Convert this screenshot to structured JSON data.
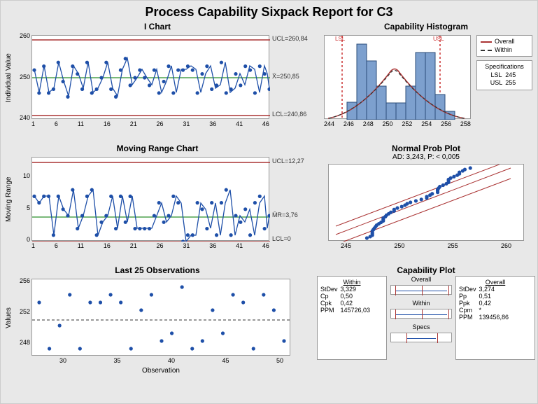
{
  "title": "Process Capability Sixpack Report for C3",
  "iChart": {
    "title": "I Chart",
    "ylabel": "Individual Value",
    "xticks": [
      1,
      6,
      11,
      16,
      21,
      26,
      31,
      36,
      41,
      46
    ],
    "yticks": [
      240,
      250,
      260
    ],
    "ucl_label": "UCL=260,84",
    "mean_label": "X̄=250,85",
    "lcl_label": "LCL=240,86"
  },
  "mrChart": {
    "title": "Moving Range Chart",
    "ylabel": "Moving Range",
    "xticks": [
      1,
      6,
      11,
      16,
      21,
      26,
      31,
      36,
      41,
      46
    ],
    "yticks": [
      0,
      5,
      10
    ],
    "ucl_label": "UCL=12,27",
    "mean_label": "M̄R=3,76",
    "lcl_label": "LCL=0"
  },
  "last25": {
    "title": "Last 25 Observations",
    "ylabel": "Values",
    "xlabel": "Observation",
    "yticks": [
      248,
      252,
      256
    ],
    "xticks": [
      30,
      35,
      40,
      45,
      50
    ]
  },
  "hist": {
    "title": "Capability Histogram",
    "lsl_label": "LSL",
    "usl_label": "USL",
    "xticks": [
      244,
      246,
      248,
      250,
      252,
      254,
      256,
      258
    ],
    "legend": {
      "overall": "Overall",
      "within": "Within"
    },
    "specs_title": "Specifications",
    "specs": {
      "lsl_name": "LSL",
      "lsl_val": "245",
      "usl_name": "USL",
      "usl_val": "255"
    }
  },
  "prob": {
    "title": "Normal Prob Plot",
    "subtitle": "AD: 3,243, P: < 0,005",
    "xticks": [
      245,
      250,
      255,
      260
    ]
  },
  "capPlot": {
    "title": "Capability Plot",
    "within_hdr": "Within",
    "overall_hdr": "Overall",
    "within": {
      "stdev_n": "StDev",
      "stdev_v": "3,329",
      "cp_n": "Cp",
      "cp_v": "0,50",
      "cpk_n": "Cpk",
      "cpk_v": "0,42",
      "ppm_n": "PPM",
      "ppm_v": "145726,03"
    },
    "overall": {
      "stdev_n": "StDev",
      "stdev_v": "3,274",
      "pp_n": "Pp",
      "pp_v": "0,51",
      "ppk_n": "Ppk",
      "ppk_v": "0,42",
      "cpm_n": "Cpm",
      "cpm_v": "*",
      "ppm_n": "PPM",
      "ppm_v": "139456,86"
    },
    "mid": {
      "overall": "Overall",
      "within": "Within",
      "specs": "Specs"
    }
  },
  "chart_data": [
    {
      "type": "line",
      "id": "I Chart",
      "x": [
        1,
        2,
        3,
        4,
        5,
        6,
        7,
        8,
        9,
        10,
        11,
        12,
        13,
        14,
        15,
        16,
        17,
        18,
        19,
        20,
        21,
        22,
        23,
        24,
        25,
        26,
        27,
        28,
        29,
        30,
        31,
        32,
        33,
        34,
        35,
        36,
        37,
        38,
        39,
        40,
        41,
        42,
        43,
        44,
        45,
        46,
        47,
        48,
        49,
        50
      ],
      "values": [
        253,
        247,
        254,
        247,
        248,
        255,
        250,
        246,
        254,
        252,
        248,
        255,
        247,
        248,
        251,
        255,
        248,
        246,
        253,
        256,
        249,
        251,
        253,
        251,
        249,
        253,
        247,
        250,
        254,
        247,
        253,
        253,
        254,
        253,
        247,
        252,
        254,
        248,
        249,
        255,
        247,
        248,
        252,
        249,
        254,
        253,
        247,
        254,
        252,
        248
      ],
      "ucl": 260.84,
      "mean": 250.85,
      "lcl": 240.86,
      "xlim": [
        1,
        50
      ],
      "ylim": [
        240,
        262
      ],
      "title": "I Chart",
      "ylabel": "Individual Value"
    },
    {
      "type": "line",
      "id": "Moving Range Chart",
      "x": [
        1,
        2,
        3,
        4,
        5,
        6,
        7,
        8,
        9,
        10,
        11,
        12,
        13,
        14,
        15,
        16,
        17,
        18,
        19,
        20,
        21,
        22,
        23,
        24,
        25,
        26,
        27,
        28,
        29,
        30,
        31,
        32,
        33,
        34,
        35,
        36,
        37,
        38,
        39,
        40,
        41,
        42,
        43,
        44,
        45,
        46,
        47,
        48,
        49,
        50
      ],
      "values": [
        7,
        6,
        7,
        7,
        1,
        7,
        5,
        4,
        8,
        2,
        4,
        7,
        8,
        1,
        3,
        4,
        7,
        2,
        7,
        3,
        7,
        2,
        2,
        2,
        2,
        4,
        6,
        3,
        4,
        7,
        6,
        0,
        1,
        1,
        6,
        5,
        2,
        6,
        1,
        6,
        8,
        1,
        4,
        3,
        5,
        1,
        6,
        7,
        2,
        4
      ],
      "ucl": 12.27,
      "mean": 3.76,
      "lcl": 0,
      "xlim": [
        1,
        50
      ],
      "ylim": [
        0,
        13
      ],
      "title": "Moving Range Chart",
      "ylabel": "Moving Range"
    },
    {
      "type": "scatter",
      "id": "Last 25 Observations",
      "x": [
        26,
        27,
        28,
        29,
        30,
        31,
        32,
        33,
        34,
        35,
        36,
        37,
        38,
        39,
        40,
        41,
        42,
        43,
        44,
        45,
        46,
        47,
        48,
        49,
        50
      ],
      "values": [
        253,
        247,
        250,
        254,
        247,
        253,
        253,
        254,
        253,
        247,
        252,
        254,
        248,
        249,
        255,
        247,
        248,
        252,
        249,
        254,
        253,
        247,
        254,
        252,
        248
      ],
      "ref": 250.8,
      "xlim": [
        26,
        50
      ],
      "ylim": [
        246,
        256
      ],
      "title": "Last 25 Observations",
      "ylabel": "Values",
      "xlabel": "Observation"
    },
    {
      "type": "bar",
      "id": "Capability Histogram",
      "categories": [
        244,
        245,
        246,
        247,
        248,
        249,
        250,
        251,
        252,
        253,
        254,
        255,
        256,
        257,
        258
      ],
      "values": [
        0,
        0,
        2,
        9,
        7,
        4,
        2,
        2,
        4,
        8,
        8,
        3,
        1,
        0,
        0
      ],
      "title": "Capability Histogram",
      "xlim": [
        243,
        259
      ],
      "lsl": 245,
      "usl": 255,
      "overlays": [
        "normal-overall",
        "normal-within"
      ]
    },
    {
      "type": "scatter",
      "id": "Normal Prob Plot",
      "title": "Normal Prob Plot",
      "subtitle": "AD: 3,243, P: < 0,005",
      "x": [
        246.5,
        246.8,
        247,
        247,
        247,
        247,
        247.1,
        247.2,
        247.3,
        247.4,
        247.6,
        247.8,
        248,
        248,
        248,
        248.2,
        248.3,
        248.5,
        248.7,
        249,
        249,
        249.3,
        249.7,
        250,
        250.2,
        250.5,
        251,
        251.5,
        252,
        252,
        252.3,
        252.5,
        253,
        253,
        253,
        253.1,
        253.2,
        253.5,
        253.8,
        254,
        254,
        254,
        254.2,
        254.5,
        254.8,
        255,
        255,
        255.3,
        255.5,
        256
      ],
      "ylim": [
        0,
        1
      ],
      "xlim": [
        243,
        261
      ],
      "annotations": [
        "center-fit",
        "upper-ci",
        "lower-ci"
      ]
    }
  ]
}
